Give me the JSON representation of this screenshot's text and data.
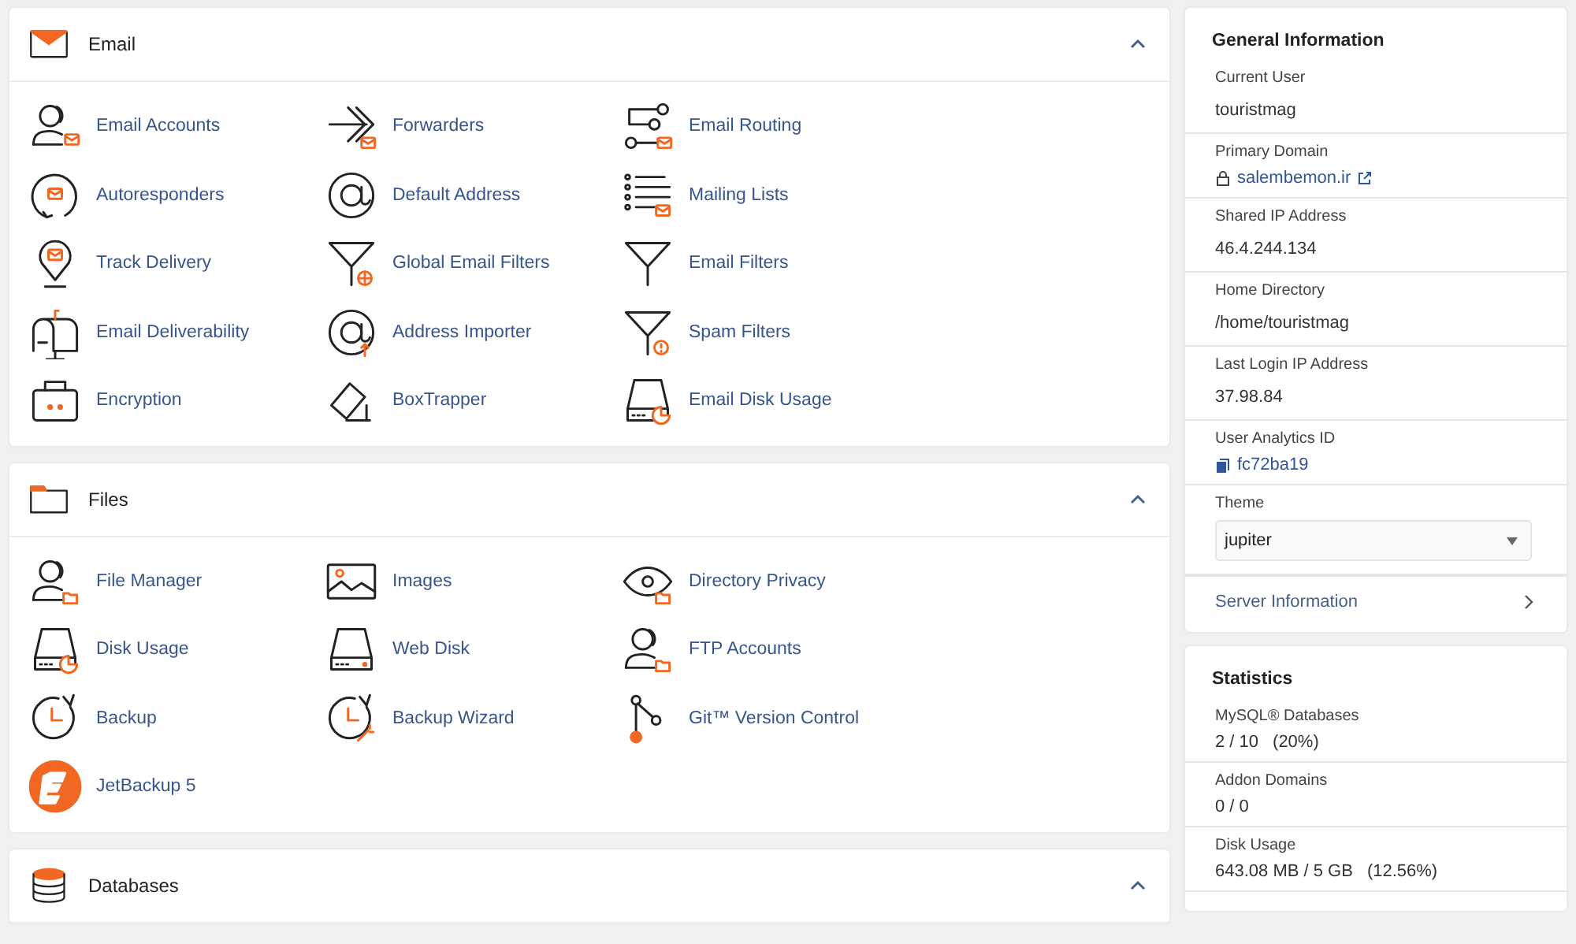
{
  "sections": [
    {
      "title": "Email",
      "kind": "email",
      "expanded": true,
      "items": [
        {
          "label": "Email Accounts"
        },
        {
          "label": "Forwarders"
        },
        {
          "label": "Email Routing"
        },
        {
          "label": "Autoresponders"
        },
        {
          "label": "Default Address"
        },
        {
          "label": "Mailing Lists"
        },
        {
          "label": "Track Delivery"
        },
        {
          "label": "Global Email Filters"
        },
        {
          "label": "Email Filters"
        },
        {
          "label": "Email Deliverability"
        },
        {
          "label": "Address Importer"
        },
        {
          "label": "Spam Filters"
        },
        {
          "label": "Encryption"
        },
        {
          "label": "BoxTrapper"
        },
        {
          "label": "Email Disk Usage"
        }
      ]
    },
    {
      "title": "Files",
      "kind": "files",
      "expanded": true,
      "items": [
        {
          "label": "File Manager"
        },
        {
          "label": "Images"
        },
        {
          "label": "Directory Privacy"
        },
        {
          "label": "Disk Usage"
        },
        {
          "label": "Web Disk"
        },
        {
          "label": "FTP Accounts"
        },
        {
          "label": "Backup"
        },
        {
          "label": "Backup Wizard"
        },
        {
          "label": "Git™ Version Control"
        },
        {
          "label": "JetBackup 5"
        }
      ]
    },
    {
      "title": "Databases",
      "kind": "databases",
      "expanded": true
    }
  ],
  "general_information": {
    "title": "General Information",
    "rows": [
      {
        "kind": "text",
        "label": "Current User",
        "value": "touristmag"
      },
      {
        "kind": "domain",
        "label": "Primary Domain",
        "value": "salembemon.ir"
      },
      {
        "kind": "text",
        "label": "Shared IP Address",
        "value": "46.4.244.134"
      },
      {
        "kind": "text",
        "label": "Home Directory",
        "value": "/home/touristmag"
      },
      {
        "kind": "text",
        "label": "Last Login IP Address",
        "value": "37.98.84"
      },
      {
        "kind": "copy",
        "label": "User Analytics ID",
        "value": "fc72ba19"
      },
      {
        "kind": "select",
        "label": "Theme",
        "value": "jupiter"
      }
    ],
    "link": "Server Information"
  },
  "statistics": {
    "title": "Statistics",
    "rows": [
      {
        "label": "MySQL® Databases",
        "value": "2 / 10",
        "percent": "(20%)"
      },
      {
        "label": "Addon Domains",
        "value": "0 / 0"
      },
      {
        "label": "Disk Usage",
        "value": "643.08 MB / 5 GB",
        "percent": "(12.56%)"
      }
    ]
  }
}
